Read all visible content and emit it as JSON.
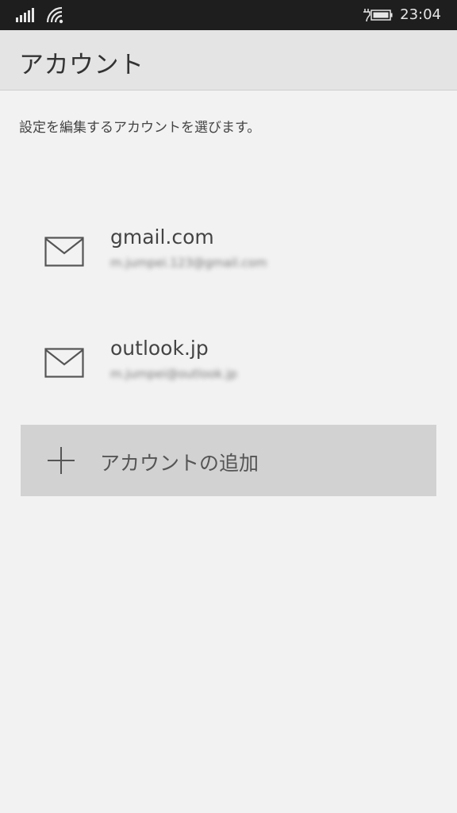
{
  "status_bar": {
    "time": "23:04",
    "icons": [
      "signal-icon",
      "wifi-icon",
      "battery-charging-icon"
    ]
  },
  "header": {
    "title": "アカウント"
  },
  "instruction": "設定を編集するアカウントを選びます。",
  "accounts": [
    {
      "name": "gmail.com",
      "email": "m.jumpei.123@gmail.com",
      "icon": "mail-icon"
    },
    {
      "name": "outlook.jp",
      "email": "m.jumpei@outlook.jp",
      "icon": "mail-icon"
    }
  ],
  "add_account": {
    "label": "アカウントの追加",
    "icon": "plus-icon"
  },
  "colors": {
    "status_bar": "#1e1e1e",
    "header_bg": "#e4e4e4",
    "page_bg": "#f2f2f2",
    "add_button_bg": "#d2d2d2"
  }
}
